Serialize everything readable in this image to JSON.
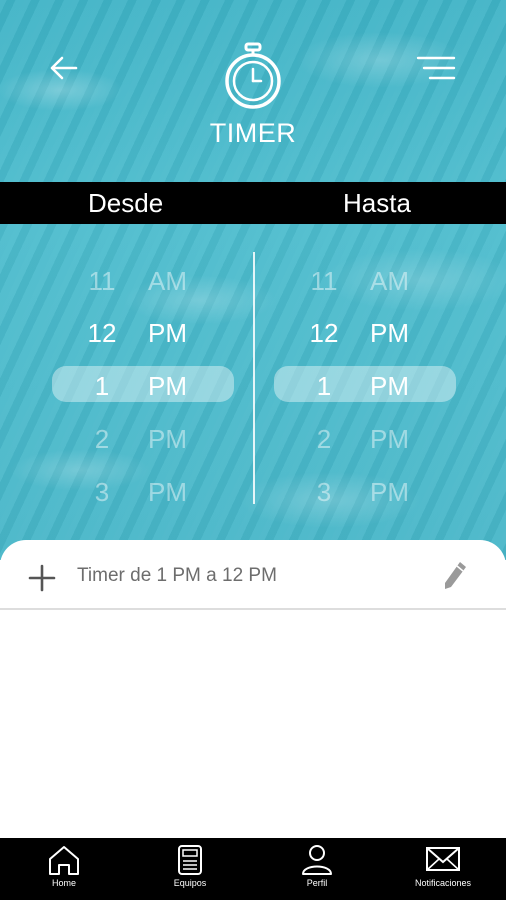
{
  "header": {
    "title": "TIMER",
    "back_icon": "arrow-left-icon",
    "menu_icon": "menu-lines-icon",
    "timer_icon": "stopwatch-icon"
  },
  "range": {
    "from_label": "Desde",
    "to_label": "Hasta"
  },
  "picker_from": {
    "rows": [
      {
        "hour": "11",
        "period": "AM"
      },
      {
        "hour": "12",
        "period": "PM"
      },
      {
        "hour": "1",
        "period": "PM"
      },
      {
        "hour": "2",
        "period": "PM"
      },
      {
        "hour": "3",
        "period": "PM"
      }
    ],
    "selected_index": 2
  },
  "picker_to": {
    "rows": [
      {
        "hour": "11",
        "period": "AM"
      },
      {
        "hour": "12",
        "period": "PM"
      },
      {
        "hour": "1",
        "period": "PM"
      },
      {
        "hour": "2",
        "period": "PM"
      },
      {
        "hour": "3",
        "period": "PM"
      }
    ],
    "selected_index": 2
  },
  "timer_list": {
    "items": [
      {
        "label": "Timer de 1 PM a 12 PM"
      }
    ]
  },
  "tabbar": {
    "tabs": [
      {
        "label": "Home",
        "icon": "home-icon"
      },
      {
        "label": "Equipos",
        "icon": "device-icon"
      },
      {
        "label": "Perfil",
        "icon": "user-icon"
      },
      {
        "label": "Notificaciones",
        "icon": "envelope-icon"
      }
    ]
  },
  "colors": {
    "water": "#47b6c8",
    "bar": "#000000",
    "text_muted": "#6d6d6d"
  }
}
